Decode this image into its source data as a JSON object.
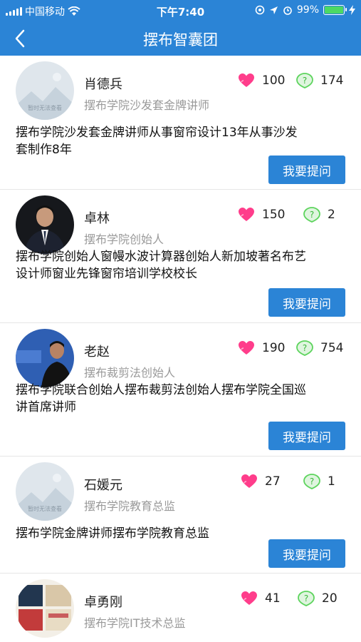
{
  "status_bar": {
    "carrier": "中国移动",
    "time": "下午7:40",
    "battery": "99%",
    "battery_level": 0.99
  },
  "nav": {
    "title": "摆布智囊团",
    "back_icon": "chevron-left-icon"
  },
  "placeholder_text": "暂时无法查看",
  "experts": [
    {
      "name": "肖德兵",
      "title": "摆布学院沙发套金牌讲师",
      "likes": "100",
      "answers": "174",
      "desc_lines": [
        "摆布学院沙发套金牌讲师从事窗帘设计13年从事沙发",
        "套制作8年"
      ],
      "ask_label": "我要提问"
    },
    {
      "name": "卓林",
      "title": "摆布学院创始人",
      "likes": "150",
      "answers": "2",
      "desc_lines": [
        "摆布学院创始人窗幔水波计算器创始人新加坡著名布艺",
        "设计师窗业先锋窗帘培训学校校长"
      ],
      "ask_label": "我要提问"
    },
    {
      "name": "老赵",
      "title": "摆布裁剪法创始人",
      "likes": "190",
      "answers": "754",
      "desc_lines": [
        "摆布学院联合创始人摆布裁剪法创始人摆布学院全国巡",
        "讲首席讲师"
      ],
      "ask_label": "我要提问"
    },
    {
      "name": "石媛元",
      "title": "摆布学院教育总监",
      "likes": "27",
      "answers": "1",
      "desc_lines": [
        "摆布学院金牌讲师摆布学院教育总监"
      ],
      "ask_label": "我要提问"
    },
    {
      "name": "卓勇刚",
      "title": "摆布学院IT技术总监",
      "likes": "41",
      "answers": "20",
      "desc_lines": [],
      "ask_label": ""
    }
  ],
  "colors": {
    "brand": "#2b84d6",
    "heart": "#ff3d8b",
    "answer": "#5dd45d"
  }
}
